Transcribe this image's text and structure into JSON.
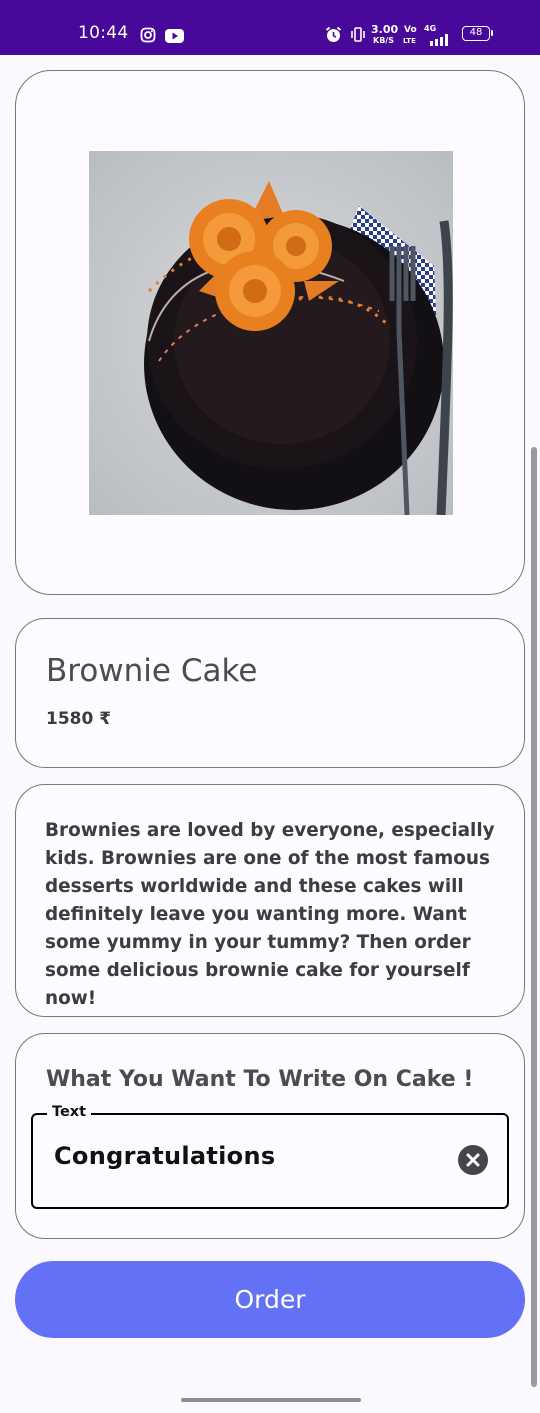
{
  "status_bar": {
    "time": "10:44",
    "net_speed_value": "3.00",
    "net_speed_unit": "KB/S",
    "volte_top": "Vo",
    "volte_bottom": "LTE",
    "network": "4G",
    "battery": "48",
    "icons": [
      "instagram-icon",
      "youtube-icon",
      "alarm-icon",
      "vibrate-icon",
      "signal-icon"
    ]
  },
  "product": {
    "image_icon": "brownie-cake-photo",
    "title": "Brownie Cake",
    "price": "1580 ₹",
    "description": "Brownies are loved by everyone, especially kids. Brownies are one of the most famous desserts worldwide and these cakes will definitely leave you wanting more. Want some yummy in your tummy? Then order some delicious brownie cake for yourself now!"
  },
  "customize": {
    "title": "What You Want To Write On Cake !",
    "field_label": "Text",
    "field_value": "Congratulations",
    "clear_icon": "clear-icon"
  },
  "order_button": {
    "label": "Order"
  },
  "colors": {
    "status_bar": "#48089a",
    "order_button": "#6371f6",
    "background": "#fbf8fe"
  }
}
